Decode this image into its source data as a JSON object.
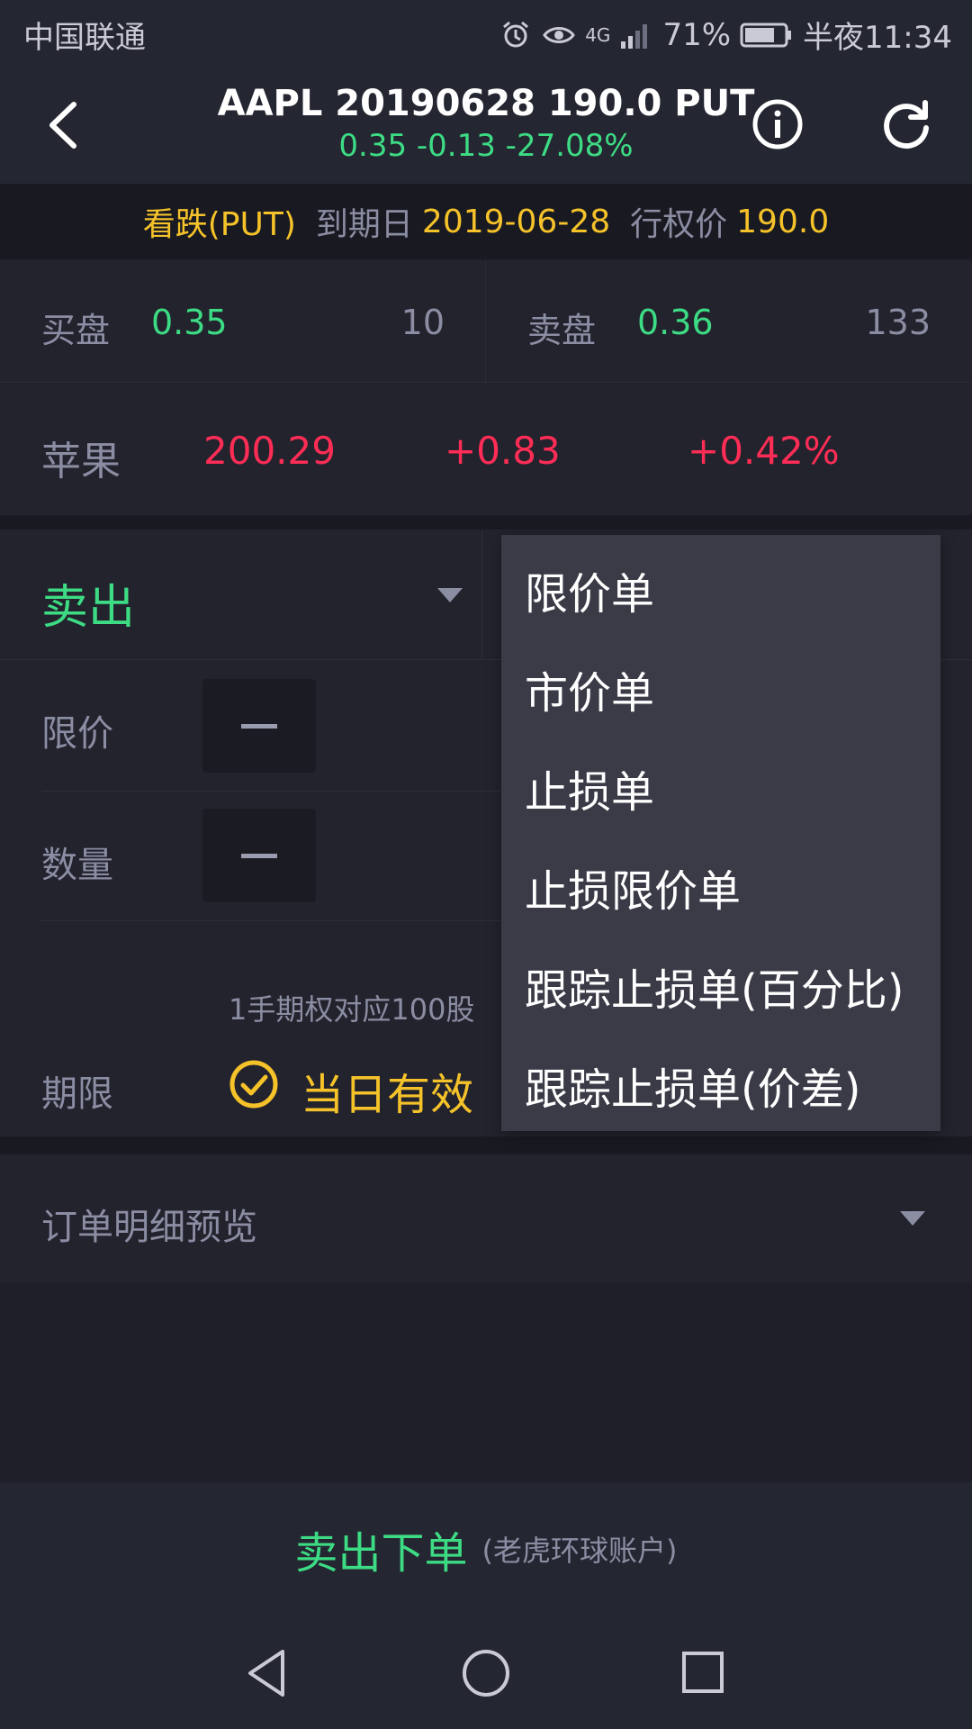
{
  "status_bar": {
    "carrier": "中国联通",
    "battery": "71%",
    "time": "半夜11:34",
    "network": "4G"
  },
  "header": {
    "title": "AAPL 20190628 190.0 PUT",
    "subtitle": "0.35 -0.13 -27.08%"
  },
  "info_strip": {
    "type": "看跌(PUT)",
    "expiry_label": "到期日",
    "expiry": "2019-06-28",
    "strike_label": "行权价",
    "strike": "190.0"
  },
  "bid": {
    "label": "买盘",
    "price": "0.35",
    "size": "10"
  },
  "ask": {
    "label": "卖盘",
    "price": "0.36",
    "size": "133"
  },
  "underlying": {
    "name": "苹果",
    "price": "200.29",
    "change": "+0.83",
    "change_pct": "+0.42%"
  },
  "order_form": {
    "side": "卖出",
    "limit_label": "限价",
    "qty_label": "数量",
    "lot_hint": "1手期权对应100股",
    "tif_label": "期限",
    "tif_value": "当日有效"
  },
  "order_type_menu": {
    "items": [
      "限价单",
      "市价单",
      "止损单",
      "止损限价单",
      "跟踪止损单(百分比)",
      "跟踪止损单(价差)"
    ]
  },
  "preview": {
    "label": "订单明细预览"
  },
  "submit": {
    "label": "卖出下单",
    "account": "(老虎环球账户)"
  },
  "colors": {
    "accent_green": "#3ddc84",
    "accent_red": "#ff2d55",
    "accent_yellow": "#f5c22a",
    "background": "#20212b"
  }
}
